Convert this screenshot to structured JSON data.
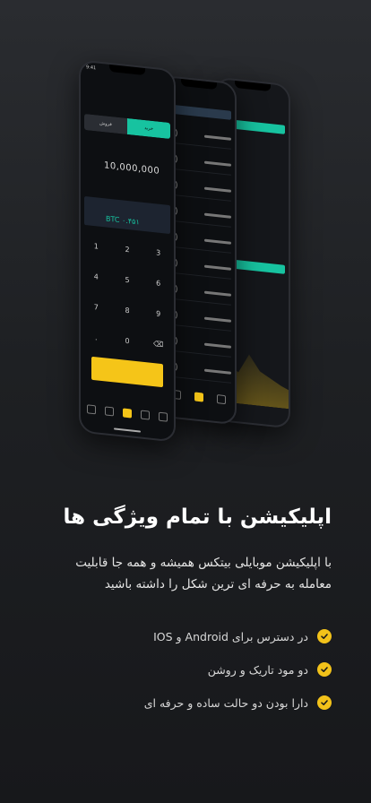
{
  "hero": {
    "title": "اپلیکیشن با تمام ویژگی ها",
    "description": "با اپلیکیشن موبایلی بیتکس همیشه و همه جا قابلیت معامله به حرفه ای ترین شکل را داشته باشید"
  },
  "features": [
    {
      "label": "در دسترس برای Android و IOS",
      "icon": "check-icon"
    },
    {
      "label": "دو مود تاریک و روشن",
      "icon": "check-icon"
    },
    {
      "label": "دارا بودن دو حالت ساده و حرفه ای",
      "icon": "check-icon"
    }
  ],
  "mockup": {
    "status_time": "9:41",
    "tab_buy": "خرید",
    "tab_sell": "فروش",
    "amount": "10,000,000",
    "btc_value": "BTC ۰.۴۵۱",
    "keypad": [
      "1",
      "2",
      "3",
      "4",
      "5",
      "6",
      "7",
      "8",
      "9",
      ".",
      "0",
      "⌫"
    ]
  },
  "colors": {
    "accent": "#f2c21a",
    "teal": "#17c3a0"
  }
}
